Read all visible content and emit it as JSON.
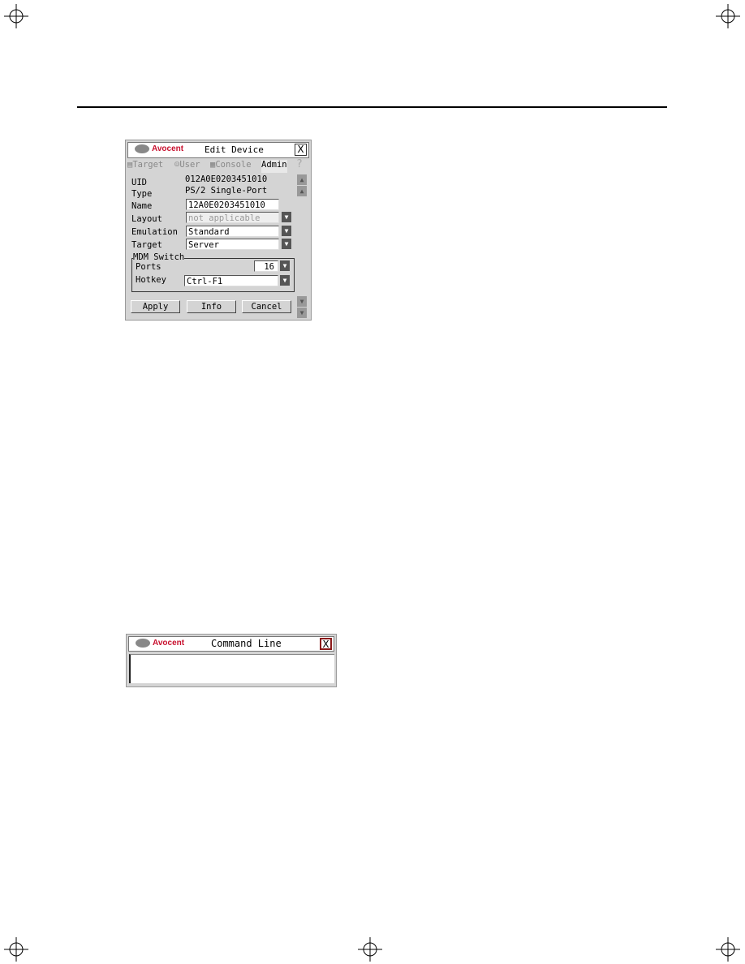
{
  "edit_device": {
    "brand": "Avocent",
    "title": "Edit Device",
    "close": "X",
    "tabs": [
      {
        "label": "Target",
        "icon": "target-icon"
      },
      {
        "label": "User",
        "icon": "user-icon"
      },
      {
        "label": "Console",
        "icon": "console-icon"
      },
      {
        "label": "Admin",
        "active": true
      },
      {
        "label": "?",
        "icon": "help-icon"
      }
    ],
    "uid_label": "UID",
    "uid_value": "012A0E0203451010",
    "type_label": "Type",
    "type_value": "PS/2 Single-Port",
    "name_label": "Name",
    "name_value": "12A0E0203451010",
    "layout_label": "Layout",
    "layout_value": "not applicable",
    "emulation_label": "Emulation",
    "emulation_value": "Standard",
    "target_label": "Target",
    "target_value": "Server",
    "group_label": "MDM Switch",
    "ports_label": "Ports",
    "ports_value": "16",
    "hotkey_label": "Hotkey",
    "hotkey_value": "Ctrl-F1",
    "buttons": {
      "apply": "Apply",
      "info": "Info",
      "cancel": "Cancel"
    }
  },
  "command_line": {
    "brand": "Avocent",
    "title": "Command Line",
    "close": "X"
  }
}
